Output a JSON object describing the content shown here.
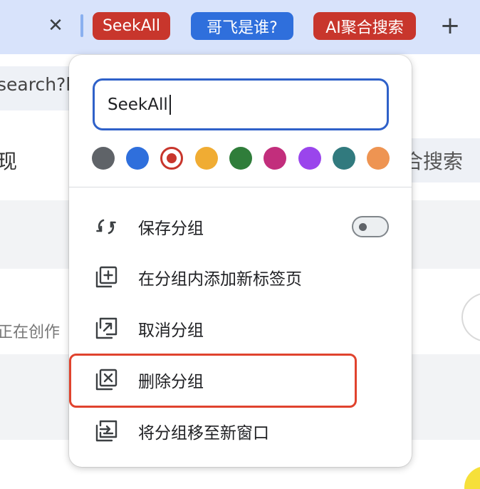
{
  "tabstrip": {
    "close_glyph": "✕",
    "groups": [
      {
        "label": "SeekAll",
        "color": "#c8362c"
      },
      {
        "label": "哥飞是谁?",
        "color": "#2f6fdc"
      },
      {
        "label": "AI聚合搜索",
        "color": "#c8362c"
      }
    ],
    "new_tab_glyph": "+"
  },
  "background": {
    "address_fragment": "search?k",
    "left_heading_fragment": "现",
    "right_fragment": "合搜索",
    "status_fragment": "正在创作"
  },
  "popup": {
    "group_name_input": {
      "value": "SeekAll",
      "placeholder": ""
    },
    "colors": [
      {
        "name": "grey",
        "hex": "#5f6368",
        "selected": false
      },
      {
        "name": "blue",
        "hex": "#2f6fdc",
        "selected": false
      },
      {
        "name": "red",
        "hex": "#c8362c",
        "selected": true
      },
      {
        "name": "yellow",
        "hex": "#f0ac33",
        "selected": false
      },
      {
        "name": "green",
        "hex": "#2f7d3a",
        "selected": false
      },
      {
        "name": "pink",
        "hex": "#c22e7c",
        "selected": false
      },
      {
        "name": "purple",
        "hex": "#9a45ec",
        "selected": false
      },
      {
        "name": "cyan",
        "hex": "#317a7e",
        "selected": false
      },
      {
        "name": "orange",
        "hex": "#ee9452",
        "selected": false
      }
    ],
    "menu": [
      {
        "id": "save-group",
        "label": "保存分组",
        "icon": "sync-icon",
        "toggle": false
      },
      {
        "id": "new-tab-in-group",
        "label": "在分组内添加新标签页",
        "icon": "add-tab-icon"
      },
      {
        "id": "ungroup",
        "label": "取消分组",
        "icon": "ungroup-icon"
      },
      {
        "id": "delete-group",
        "label": "删除分组",
        "icon": "delete-group-icon",
        "highlighted": true
      },
      {
        "id": "move-group",
        "label": "将分组移至新窗口",
        "icon": "move-window-icon"
      }
    ]
  },
  "accent": {
    "highlight_border": "#e0432e",
    "input_border": "#2f61c9"
  }
}
